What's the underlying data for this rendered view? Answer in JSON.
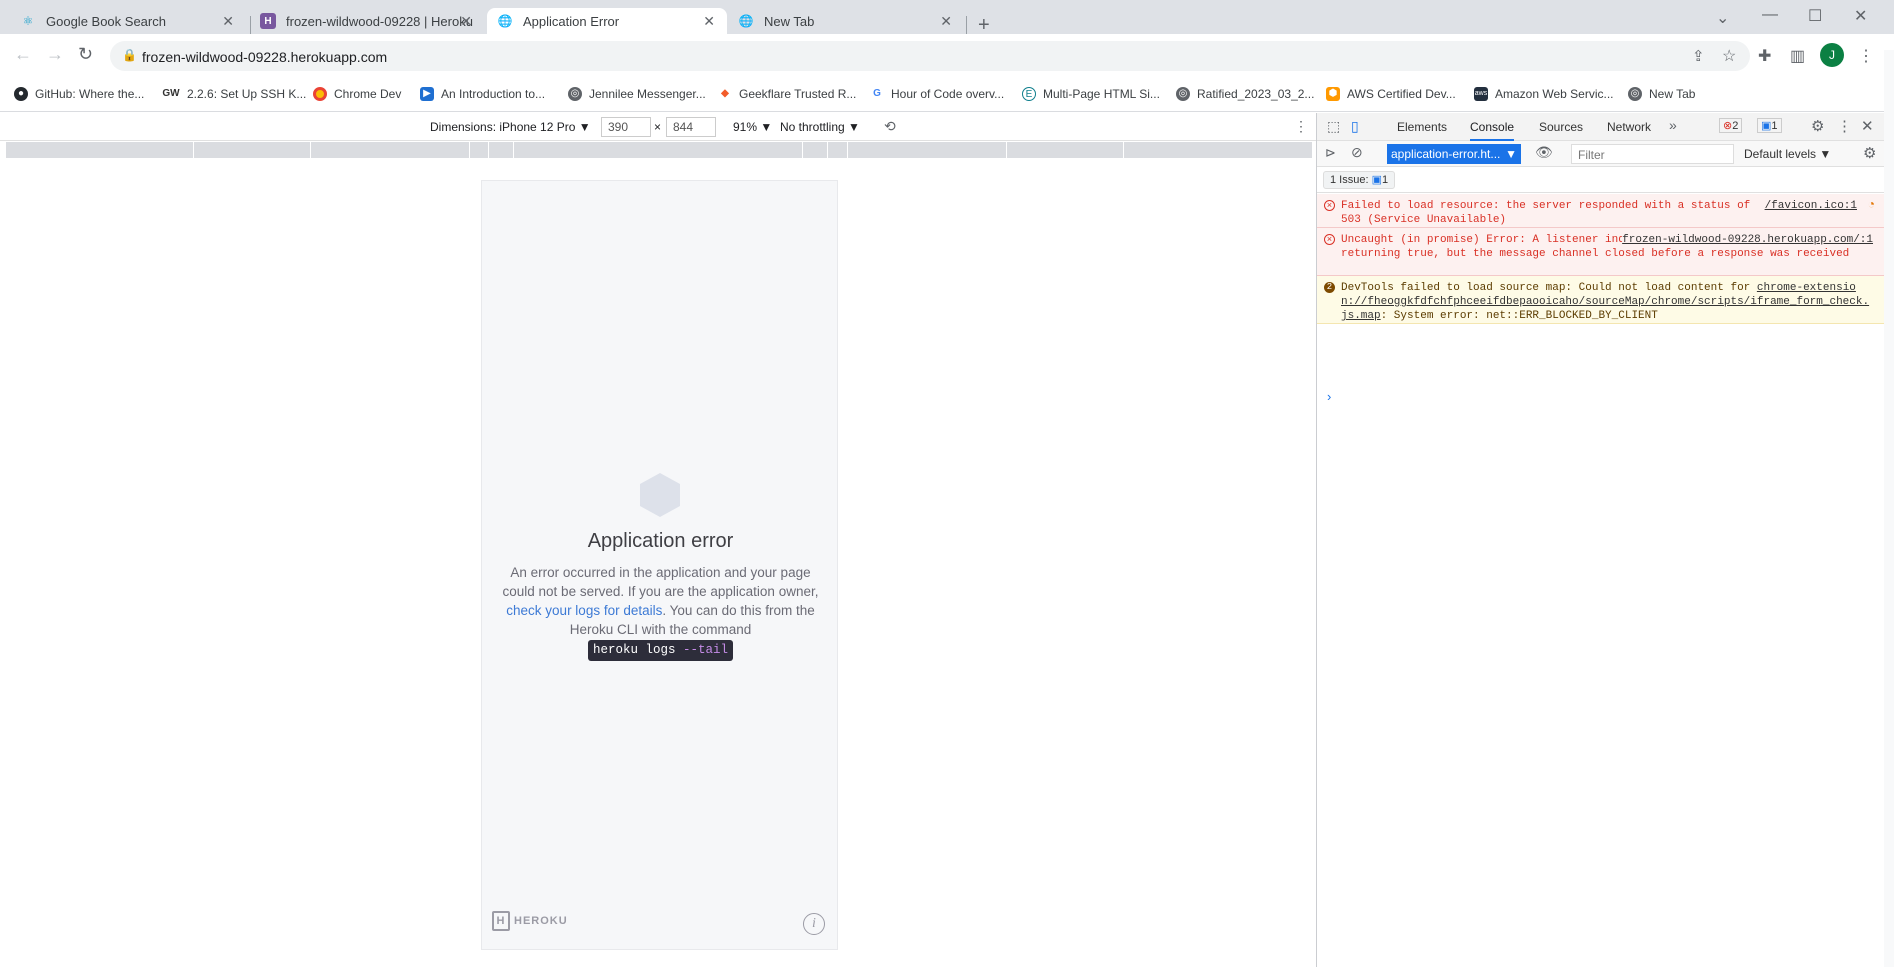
{
  "tabs": [
    {
      "title": "Google Book Search",
      "icon": "react-icon",
      "active": false
    },
    {
      "title": "frozen-wildwood-09228 | Heroku",
      "icon": "heroku-icon",
      "active": false
    },
    {
      "title": "Application Error",
      "icon": "globe-icon",
      "active": true
    },
    {
      "title": "New Tab",
      "icon": "globe-icon",
      "active": false
    }
  ],
  "address": {
    "url": "frozen-wildwood-09228.herokuapp.com"
  },
  "avatar": {
    "letter": "J"
  },
  "bookmarks": [
    {
      "label": "GitHub: Where the...",
      "icon": "github-icon"
    },
    {
      "label": "2.2.6: Set Up SSH K...",
      "icon": "gw-icon"
    },
    {
      "label": "Chrome Dev",
      "icon": "chrome-icon"
    },
    {
      "label": "An Introduction to...",
      "icon": "play-icon"
    },
    {
      "label": "Jennilee Messenger...",
      "icon": "globe-icon"
    },
    {
      "label": "Geekflare Trusted R...",
      "icon": "geekflare-icon"
    },
    {
      "label": "Hour of Code overv...",
      "icon": "google-icon"
    },
    {
      "label": "Multi-Page HTML Si...",
      "icon": "e-icon"
    },
    {
      "label": "Ratified_2023_03_2...",
      "icon": "globe-icon"
    },
    {
      "label": "AWS Certified Dev...",
      "icon": "aws-cert-icon"
    },
    {
      "label": "Amazon Web Servic...",
      "icon": "aws-icon"
    },
    {
      "label": "New Tab",
      "icon": "globe-icon"
    }
  ],
  "device_toolbar": {
    "dimensions": "Dimensions: iPhone 12 Pro",
    "width": "390",
    "times": "×",
    "height": "844",
    "zoom": "91%",
    "throttling": "No throttling"
  },
  "page": {
    "title": "Application error",
    "body_1": "An error occurred in the application and your page could not be served. If you are the application owner, ",
    "link": "check your logs for details",
    "body_2": ". You can do this from the Heroku CLI with the command ",
    "cmd_main": "heroku logs ",
    "cmd_flag": "--tail",
    "logo_text": "HEROKU"
  },
  "devtools": {
    "tabs": [
      "Elements",
      "Console",
      "Sources",
      "Network"
    ],
    "active_tab": "Console",
    "error_count": "2",
    "issue_count": "1",
    "context": "application-error.ht...",
    "filter_placeholder": "Filter",
    "levels": "Default levels",
    "issues_label": "1 Issue:",
    "issues_num": "1",
    "messages": [
      {
        "level": "error",
        "text": "Failed to load resource: the server responded with a status of 503 (Service Unavailable)",
        "source": "/favicon.ico:1"
      },
      {
        "level": "error",
        "text": "Uncaught (in promise) Error: A listener indicated an asynchronous response by returning true, but the message channel closed before a response was received",
        "source": "frozen-wildwood-09228.herokuapp.com/:1"
      },
      {
        "level": "warn",
        "count": "2",
        "text_1": "DevTools failed to load source map: Could not load content for ",
        "link": "chrome-extension://fheoggkfdfchfphceeifdbepaooicaho/sourceMap/chrome/scripts/iframe_form_check.js.map",
        "text_2": ": System error: net::ERR_BLOCKED_BY_CLIENT"
      }
    ],
    "prompt": "›"
  },
  "colors": {
    "accent": "#1a73e8",
    "error": "#d93025",
    "heroku_purple": "#79589f"
  }
}
